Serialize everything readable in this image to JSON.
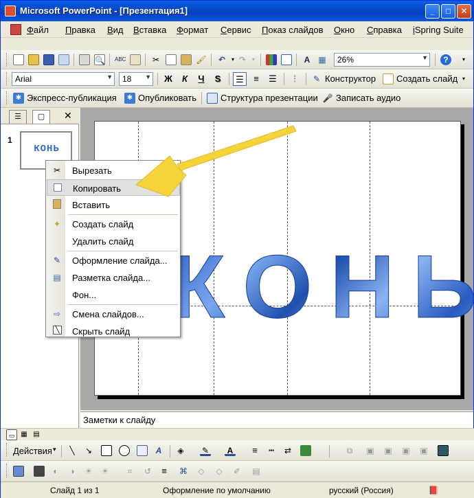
{
  "window": {
    "title": "Microsoft PowerPoint - [Презентация1]"
  },
  "menu": {
    "items": [
      "Файл",
      "Правка",
      "Вид",
      "Вставка",
      "Формат",
      "Сервис",
      "Показ слайдов",
      "Окно",
      "Справка",
      "iSpring Suite"
    ]
  },
  "standard_toolbar": {
    "zoom": "26%"
  },
  "format_toolbar": {
    "font": "Arial",
    "size": "18",
    "bold": "Ж",
    "italic": "К",
    "underline": "Ч",
    "shadow": "S",
    "designer": "Конструктор",
    "new_slide": "Создать слайд"
  },
  "ispring_toolbar": {
    "quick_publish": "Экспресс-публикация",
    "publish": "Опубликовать",
    "structure": "Структура презентации",
    "record_audio": "Записать аудио"
  },
  "slides_pane": {
    "slide_number": "1",
    "thumb_text": "КОНЬ"
  },
  "slide": {
    "text": "КОНЬ"
  },
  "notes": {
    "placeholder": "Заметки к слайду"
  },
  "context_menu": {
    "items": [
      {
        "label": "Вырезать",
        "icon": "scissors-icon"
      },
      {
        "label": "Копировать",
        "icon": "copy-icon"
      },
      {
        "label": "Вставить",
        "icon": "paste-icon"
      },
      {
        "label": "Создать слайд",
        "icon": "new-slide-icon"
      },
      {
        "label": "Удалить слайд",
        "icon": ""
      },
      {
        "label": "Оформление слайда...",
        "icon": "design-icon"
      },
      {
        "label": "Разметка слайда...",
        "icon": "layout-icon"
      },
      {
        "label": "Фон...",
        "icon": ""
      },
      {
        "label": "Смена слайдов...",
        "icon": "transition-icon"
      },
      {
        "label": "Скрыть слайд",
        "icon": "hide-slide-icon"
      }
    ],
    "highlighted": "Копировать"
  },
  "drawing_toolbar": {
    "actions": "Действия"
  },
  "status": {
    "slide_of": "Слайд 1 из 1",
    "design": "Оформление по умолчанию",
    "language": "русский (Россия)"
  },
  "colors": {
    "arrow": "#f5d33a",
    "title_bar": "#0849c8",
    "slide_text": "#4a86dc"
  }
}
